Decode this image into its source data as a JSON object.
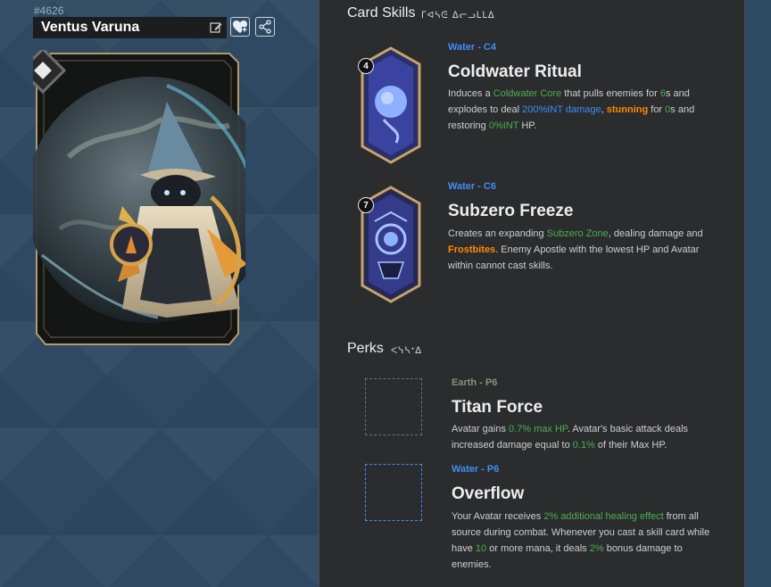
{
  "card": {
    "id": "#4626",
    "name": "Ventus Varuna"
  },
  "colors": {
    "water": "#3e8ef7",
    "earth": "#8a8f7a",
    "green": "#4caf50",
    "orange": "#ff8a00"
  },
  "icons": [
    "edit-icon",
    "favorite-add-icon",
    "share-icon",
    "element-diamond-icon"
  ],
  "skills_section": {
    "title": "Card Skills",
    "glyph": "ᒥᐊᓴᕮ ᐃᓕᓗᒪᒪᐃ"
  },
  "skills": [
    {
      "tag": "Water - C4",
      "cost": "4",
      "name": "Coldwater Ritual",
      "desc": [
        {
          "t": "Induces a ",
          "c": ""
        },
        {
          "t": "Coldwater Core",
          "c": "g"
        },
        {
          "t": " that pulls enemies for ",
          "c": ""
        },
        {
          "t": "6",
          "c": "g"
        },
        {
          "t": "s and explodes to deal ",
          "c": ""
        },
        {
          "t": "200%INT damage",
          "c": "b"
        },
        {
          "t": ", ",
          "c": ""
        },
        {
          "t": "stunning",
          "c": "o"
        },
        {
          "t": " for ",
          "c": ""
        },
        {
          "t": "0",
          "c": "g"
        },
        {
          "t": "s and restoring ",
          "c": ""
        },
        {
          "t": "0%INT",
          "c": "g"
        },
        {
          "t": " HP.",
          "c": ""
        }
      ]
    },
    {
      "tag": "Water - C6",
      "cost": "7",
      "name": "Subzero Freeze",
      "desc": [
        {
          "t": "Creates an expanding ",
          "c": ""
        },
        {
          "t": "Subzero Zone",
          "c": "g"
        },
        {
          "t": ", dealing damage and ",
          "c": ""
        },
        {
          "t": "Frostbites",
          "c": "o"
        },
        {
          "t": ". Enemy Apostle with the lowest HP and Avatar within cannot cast skills.",
          "c": ""
        }
      ]
    }
  ],
  "perks_section": {
    "title": "Perks",
    "glyph": "ᐸᓭᓴᐩᐃ"
  },
  "perks": [
    {
      "tag": "Earth - P6",
      "name": "Titan Force",
      "desc": [
        {
          "t": "Avatar gains ",
          "c": ""
        },
        {
          "t": "0.7% max HP",
          "c": "g"
        },
        {
          "t": ". Avatar's basic attack deals increased damage equal to ",
          "c": ""
        },
        {
          "t": "0.1%",
          "c": "g"
        },
        {
          "t": " of their Max HP.",
          "c": ""
        }
      ]
    },
    {
      "tag": "Water - P6",
      "name": "Overflow",
      "desc": [
        {
          "t": "Your Avatar receives ",
          "c": ""
        },
        {
          "t": "2% additional healing effect",
          "c": "g"
        },
        {
          "t": " from all source during combat. Whenever you cast a skill card while have ",
          "c": ""
        },
        {
          "t": "10",
          "c": "g"
        },
        {
          "t": " or more mana, it deals ",
          "c": ""
        },
        {
          "t": "2%",
          "c": "g"
        },
        {
          "t": " bonus damage to enemies.",
          "c": ""
        }
      ]
    }
  ]
}
